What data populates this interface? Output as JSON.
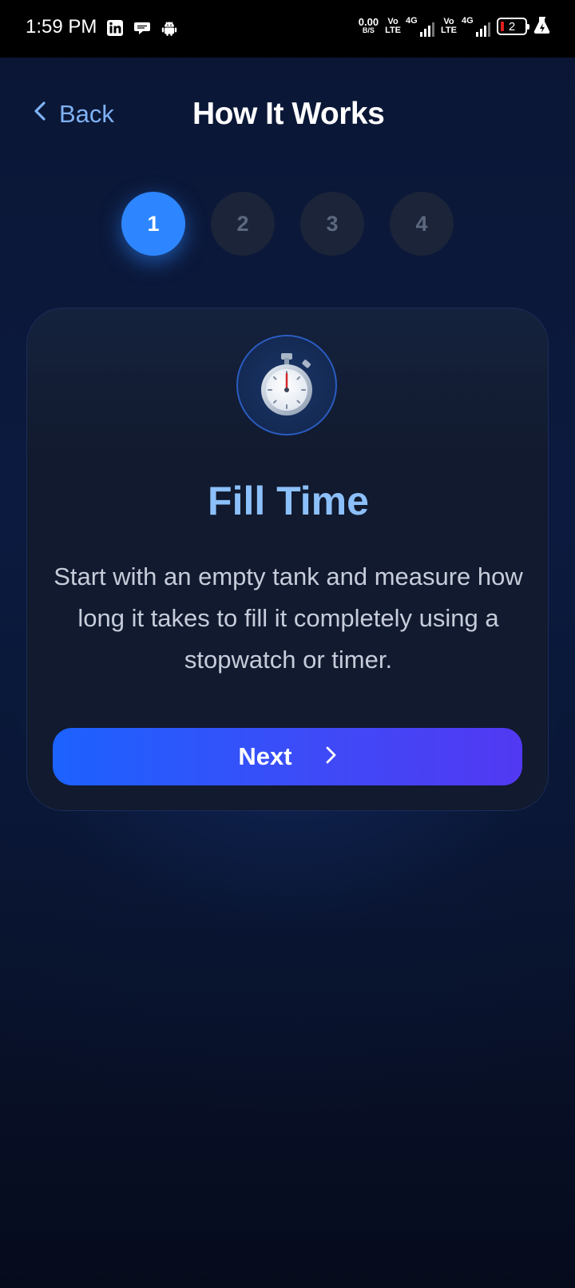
{
  "status_bar": {
    "time": "1:59 PM",
    "net_speed_value": "0.00",
    "net_speed_unit": "B/S",
    "sim1": {
      "volte_top": "Vo",
      "volte_bottom": "LTE",
      "network": "4G"
    },
    "sim2": {
      "volte_top": "Vo",
      "volte_bottom": "LTE",
      "network": "4G"
    },
    "battery_level": "2",
    "icons": [
      "linkedin-icon",
      "chat-bubble-icon",
      "android-icon",
      "battery-saver-icon"
    ]
  },
  "header": {
    "back_label": "Back",
    "title": "How It Works"
  },
  "steps": [
    "1",
    "2",
    "3",
    "4"
  ],
  "active_step": 1,
  "card": {
    "icon": "stopwatch-icon",
    "title": "Fill Time",
    "description": "Start with an empty tank and measure how long it takes to fill it completely using a stopwatch or timer.",
    "next_label": "Next"
  },
  "colors": {
    "accent": "#2d86ff",
    "title_accent": "#8cc0fa",
    "back_link": "#7fb2f5",
    "button_gradient_start": "#1c62ff",
    "button_gradient_end": "#5238f2",
    "battery_low": "#e02020"
  }
}
